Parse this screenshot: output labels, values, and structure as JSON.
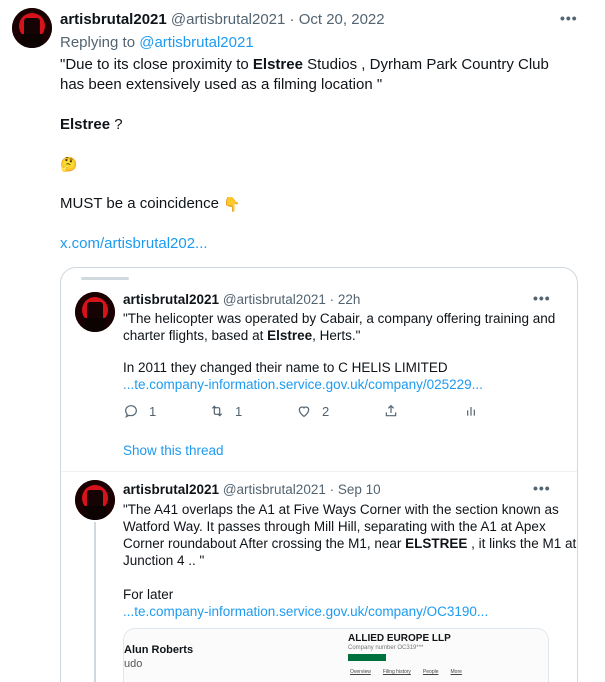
{
  "tweet": {
    "display_name": "artisbrutal2021",
    "handle": "@artisbrutal2021",
    "date": "· Oct 20, 2022",
    "replying_prefix": "Replying to",
    "replying_to": "@artisbrutal2021",
    "line1_a": "\"Due to its close proximity to ",
    "line1_b": "Elstree",
    "line1_c": " Studios , Dyrham Park Country Club",
    "line2": "has been extensively used as a filming location \"",
    "line3_a": "Elstree",
    "line3_b": " ?",
    "thinking_emoji": "🤔",
    "line5": "MUST be a coincidence ",
    "pointing_emoji": "👇",
    "link": "x.com/artisbrutal202..."
  },
  "quote1": {
    "display_name": "artisbrutal2021",
    "handle": "@artisbrutal2021",
    "date": "· 22h",
    "line1": "\"The helicopter was operated by Cabair, a company offering training and",
    "line2_a": "charter flights, based at ",
    "line2_b": "Elstree",
    "line2_c": ", Herts.\"",
    "line3": "In 2011 they changed their name to C HELIS LIMITED",
    "link": "...te.company-information.service.gov.uk/company/025229...",
    "replies": "1",
    "retweets": "1",
    "likes": "2",
    "show_thread": "Show this thread"
  },
  "quote2": {
    "display_name": "artisbrutal2021",
    "handle": "@artisbrutal2021",
    "date": "· Sep 10",
    "line1": "\"The A41 overlaps the A1 at Five Ways Corner with the section known as",
    "line2": "Watford Way. It passes through Mill Hill, separating with the A1 at Apex",
    "line3_a": "Corner roundabout After crossing the M1, near ",
    "line3_b": "ELSTREE",
    "line3_c": " , it links the M1 at",
    "line4": "Junction 4 .. \"",
    "line5": "For later",
    "link": "...te.company-information.service.gov.uk/company/OC3190..."
  },
  "preview": {
    "name": "Alun Roberts",
    "sub": "udo",
    "company": "ALLIED EUROPE LLP",
    "company_number": "Company number OC319***",
    "tabs": [
      "Overview",
      "Filing history",
      "People",
      "More"
    ]
  },
  "icons": {
    "more": "more-horizontal-icon",
    "reply": "reply-icon",
    "retweet": "retweet-icon",
    "like": "heart-icon",
    "share": "share-icon",
    "analytics": "analytics-icon"
  },
  "colors": {
    "link": "#1d9bf0",
    "secondary_text": "#536471",
    "border": "#cfd9de",
    "avatar_red": "#d4141a"
  }
}
